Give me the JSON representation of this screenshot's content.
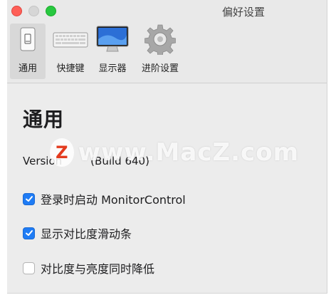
{
  "window": {
    "title": "偏好设置"
  },
  "toolbar": {
    "items": [
      {
        "label": "通用",
        "icon": "general-switch-icon",
        "selected": true
      },
      {
        "label": "快捷键",
        "icon": "keyboard-icon",
        "selected": false
      },
      {
        "label": "显示器",
        "icon": "display-monitor-icon",
        "selected": false
      },
      {
        "label": "进阶设置",
        "icon": "gear-icon",
        "selected": false
      }
    ]
  },
  "content": {
    "heading": "通用",
    "version_prefix": "Version",
    "version_suffix": "(Build 640)",
    "options": [
      {
        "label": "登录时启动 MonitorControl",
        "checked": true
      },
      {
        "label": "显示对比度滑动条",
        "checked": true
      },
      {
        "label": "对比度与亮度同时降低",
        "checked": false
      }
    ]
  },
  "watermark": {
    "logo": "Z",
    "text": "www.MacZ.com"
  },
  "colors": {
    "accent": "#1f7cf5",
    "close": "#fe5f57",
    "zoom": "#28c840"
  }
}
